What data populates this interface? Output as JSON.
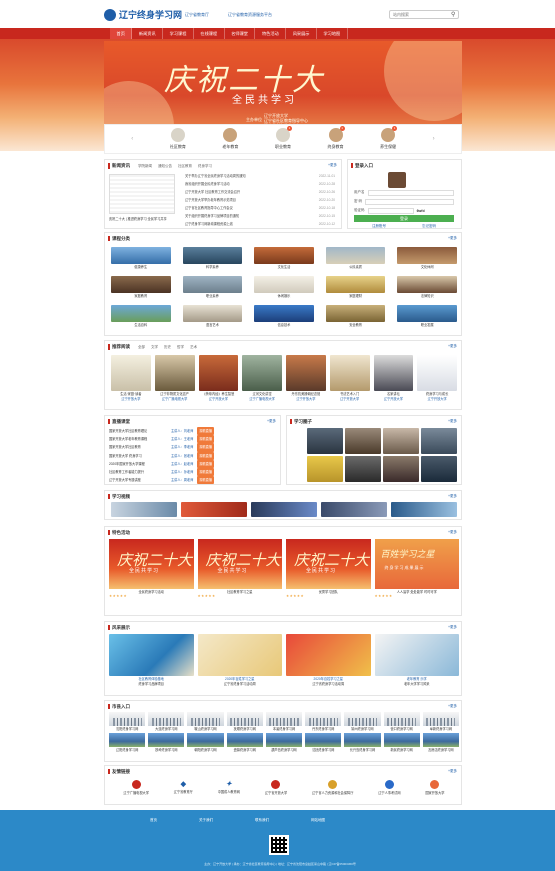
{
  "header": {
    "logo_text": "辽宁终身学习网",
    "links": [
      "辽宁省教育厅",
      "辽宁省教育资源服务平台"
    ],
    "search_placeholder": "站内搜索"
  },
  "nav": {
    "items": [
      "首页",
      "新闻资讯",
      "学习课程",
      "在线课程",
      "名师课堂",
      "特色活动",
      "风采展示",
      "学习地图"
    ]
  },
  "hero": {
    "title": "庆祝二十大",
    "subtitle": "全民共学习",
    "lines": [
      "辽宁开放大学",
      "辽宁省社区教育指导中心",
      "辽宁省老年教育中心"
    ],
    "org": "主办单位"
  },
  "quick_icons": [
    {
      "label": "社区教育",
      "badge": ""
    },
    {
      "label": "老年教育",
      "badge": ""
    },
    {
      "label": "职业教育",
      "badge": "1"
    },
    {
      "label": "终身教育",
      "badge": "1"
    },
    {
      "label": "养生保健",
      "badge": "1"
    }
  ],
  "news": {
    "title": "新闻资讯",
    "tabs": [
      "学院新闻",
      "通知公告",
      "社区教育",
      "终身学习"
    ],
    "more": "+更多",
    "featured_caption": "庆祝二十大 | 推进终身学习 全民学习共享",
    "items": [
      {
        "t": "关于举办辽宁省全民终身学习活动周的通知",
        "d": "2022-11-01"
      },
      {
        "t": "我省组织开展全民终身学习活动",
        "d": "2022-10-28"
      },
      {
        "t": "辽宁开放大学 社区教育工作交流会召开",
        "d": "2022-10-26"
      },
      {
        "t": "辽宁开放大学举办老年教育示范项目",
        "d": "2022-10-20"
      },
      {
        "t": "辽宁省社区教育指导中心工作会议",
        "d": "2022-10-18"
      },
      {
        "t": "关于组织开展终身学习品牌项目的通知",
        "d": "2022-10-15"
      },
      {
        "t": "辽宁终身学习网新增课程资源上线",
        "d": "2022-10-12"
      }
    ]
  },
  "login": {
    "title": "登录入口",
    "username": "用户名",
    "password": "密 码",
    "captcha": "验证码",
    "captcha_code": "6wfd",
    "button": "登录",
    "register": "注册账号",
    "forgot": "忘记密码"
  },
  "courses": {
    "title": "课程分类",
    "more": "+更多",
    "items": [
      "健康养生",
      "科学素养",
      "文化生活",
      "公民素质",
      "文化休闲",
      "家庭教育",
      "职业素养",
      "休闲娱乐",
      "家庭理财",
      "法律知识",
      "生活百科",
      "语言艺术",
      "信息技术",
      "安全教育",
      "职业发展"
    ]
  },
  "recommend": {
    "title": "推荐阅读",
    "tabs": [
      "全部",
      "文学",
      "历史",
      "哲学",
      "艺术"
    ],
    "more": "+更多",
    "books": [
      {
        "t": "生活·家庭·读者",
        "s": "辽宁开放大学"
      },
      {
        "t": "辽宁非物质文化遗产",
        "s": "辽宁广播电视大学"
      },
      {
        "t": "《黄帝内经》养生智慧",
        "s": "辽宁开放大学"
      },
      {
        "t": "辽河文化讲堂",
        "s": "辽宁广播电视大学"
      },
      {
        "t": "丹东抗美援朝纪念馆",
        "s": "辽宁开放大学"
      },
      {
        "t": "书法艺术入门",
        "s": "辽宁开放大学"
      },
      {
        "t": "名家讲坛",
        "s": "辽宁开放大学"
      },
      {
        "t": "终身学习与成长",
        "s": "辽宁开放大学"
      }
    ]
  },
  "live": {
    "title": "直播课堂",
    "more": "+更多",
    "rows": [
      {
        "t": "国家开放大学社区教育理论",
        "s": "主讲人：刘老师",
        "b": "观看直播"
      },
      {
        "t": "国家开放大学老年教育课程",
        "s": "主讲人：王老师",
        "b": "观看直播"
      },
      {
        "t": "国家开放大学社区教育",
        "s": "主讲人：李老师",
        "b": "观看直播"
      },
      {
        "t": "国家开放大学 终身学习",
        "s": "主讲人：张老师",
        "b": "观看直播"
      },
      {
        "t": "2020年国家开放大学课程",
        "s": "主讲人：赵老师",
        "b": "观看直播"
      },
      {
        "t": "社区教育工作者能力提升",
        "s": "主讲人：孙老师",
        "b": "观看直播"
      },
      {
        "t": "辽宁开放大学专题讲座",
        "s": "主讲人：周老师",
        "b": "观看直播"
      }
    ]
  },
  "learn_video": {
    "title": "学习视频",
    "more": "+更多"
  },
  "study_circle": {
    "title": "学习圈子",
    "more": "+更多"
  },
  "events": {
    "title": "特色活动",
    "more": "+更多",
    "cards": [
      {
        "title": "庆祝二十大",
        "sub": "全民共学习",
        "caption": "全民终身学习活动"
      },
      {
        "title": "庆祝二十大",
        "sub": "全民共学习",
        "caption": "社区教育学习之星"
      },
      {
        "title": "庆祝二十大",
        "sub": "全民共学习",
        "caption": "优秀学习团队"
      },
      {
        "title": "百姓学习之星",
        "sub": "终身学习成果展示",
        "caption": "人人皆学 处处能学 时时可学"
      }
    ]
  },
  "showcase": {
    "title": "风采展示",
    "more": "+更多",
    "cards": [
      {
        "caption": "社区教育体验基地",
        "sub": "终身学习品牌项目"
      },
      {
        "caption": "2020年百姓学习之星",
        "sub": "辽宁省终身学习活动周"
      },
      {
        "caption": "2020年百姓学习之星",
        "sub": "辽宁省终身学习活动周"
      },
      {
        "caption": "老年教育 乐学",
        "sub": "老年大学学习风采"
      }
    ]
  },
  "cities": {
    "title": "市县入口",
    "more": "+更多",
    "items": [
      "沈阳终身学习网",
      "大连终身学习网",
      "鞍山终身学习网",
      "抚顺终身学习网",
      "本溪终身学习网",
      "丹东终身学习网",
      "锦州终身学习网",
      "营口终身学习网",
      "阜新终身学习网",
      "辽阳终身学习网",
      "铁岭终身学习网",
      "朝阳终身学习网",
      "盘锦终身学习网",
      "葫芦岛终身学习网",
      "沈抚终身学习网",
      "长兴岛终身学习网",
      "新民终身学习网",
      "瓦房店终身学习网"
    ]
  },
  "friends": {
    "title": "友情链接",
    "more": "+更多",
    "items": [
      "辽宁广播电视大学",
      "辽宁省教育厅",
      "中国成人教育网",
      "辽宁省开放大学",
      "辽宁省人力资源和社会保障厅",
      "辽宁人事考试网",
      "国家开放大学"
    ]
  },
  "footer": {
    "links": [
      "首页",
      "关于我们",
      "联系我们",
      "网站地图"
    ],
    "copyright": "主办：辽宁开放大学 | 承办：辽宁省社区教育指导中心 | 地址：辽宁省沈阳市皇姑区崇山中路 | 辽ICP备05003360号"
  },
  "colors": {
    "primary": "#c8281e",
    "blue": "#1f5ea8",
    "footer": "#2c89c8"
  }
}
